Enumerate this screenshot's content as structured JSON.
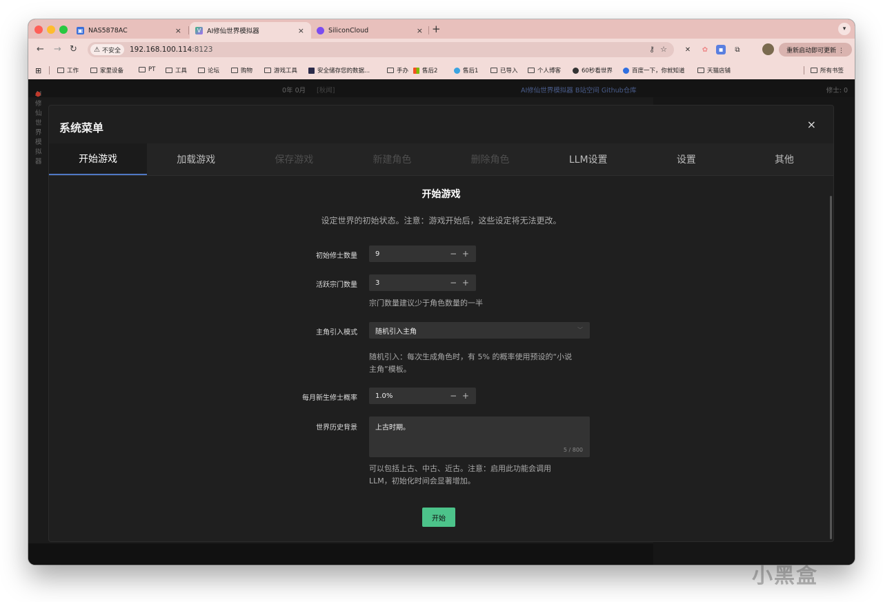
{
  "browser": {
    "tabs": [
      {
        "title": "NAS5878AC",
        "active": false
      },
      {
        "title": "AI修仙世界模拟器",
        "active": true
      },
      {
        "title": "SiliconCloud",
        "active": false
      }
    ],
    "new_tab": "+",
    "tab_close": "×",
    "url_badge": "不安全",
    "url_host": "192.168.100.114",
    "url_port": ":8123",
    "update_label": "重新启动即可更新 ⋮",
    "bookmarks": [
      "工作",
      "家里设备",
      "PT",
      "工具",
      "论坛",
      "购物",
      "游戏工具",
      "安全储存您的数据...",
      "手办",
      "售后2",
      "售后1",
      "已导入",
      "个人博客",
      "60秒看世界",
      "百度一下，你就知道",
      "天猫店铺"
    ],
    "all_bookmarks": "所有书签"
  },
  "app_header": {
    "title": "AI修仙世界模拟器",
    "date": "0年 0月",
    "date_extra": "[秋闻]",
    "link_text": "AI修仙世界模拟器 B站空间 Github仓库",
    "count": "修士: 0"
  },
  "modal": {
    "title": "系统菜单",
    "close": "×",
    "tabs": [
      {
        "label": "开始游戏",
        "state": "active"
      },
      {
        "label": "加载游戏",
        "state": "normal"
      },
      {
        "label": "保存游戏",
        "state": "disabled"
      },
      {
        "label": "新建角色",
        "state": "disabled"
      },
      {
        "label": "删除角色",
        "state": "disabled"
      },
      {
        "label": "LLM设置",
        "state": "normal"
      },
      {
        "label": "设置",
        "state": "normal"
      },
      {
        "label": "其他",
        "state": "normal"
      }
    ],
    "section_title": "开始游戏",
    "section_desc": "设定世界的初始状态。注意：游戏开始后，这些设定将无法更改。",
    "form": {
      "initial_cultivators": {
        "label": "初始修士数量",
        "value": "9",
        "stepper": "− +"
      },
      "active_sects": {
        "label": "活跃宗门数量",
        "value": "3",
        "stepper": "− +",
        "hint": "宗门数量建议少于角色数量的一半"
      },
      "protagonist_mode": {
        "label": "主角引入模式",
        "value": "随机引入主角",
        "arrow": "﹀",
        "hint_line1": "随机引入：每次生成角色时，有 5% 的概率使用预设的“小说",
        "hint_line2": "主角”模板。"
      },
      "monthly_rate": {
        "label": "每月新生修士概率",
        "value": "1.0%",
        "stepper": "− +"
      },
      "history": {
        "label": "世界历史背景",
        "value": "上古时期。",
        "counter": "5 / 800",
        "hint_line1": "可以包括上古、中古、近古。注意：启用此功能会调用",
        "hint_line2": "LLM，初始化时间会显著增加。"
      }
    },
    "start_button": "开始"
  },
  "watermark": "小黑盒"
}
